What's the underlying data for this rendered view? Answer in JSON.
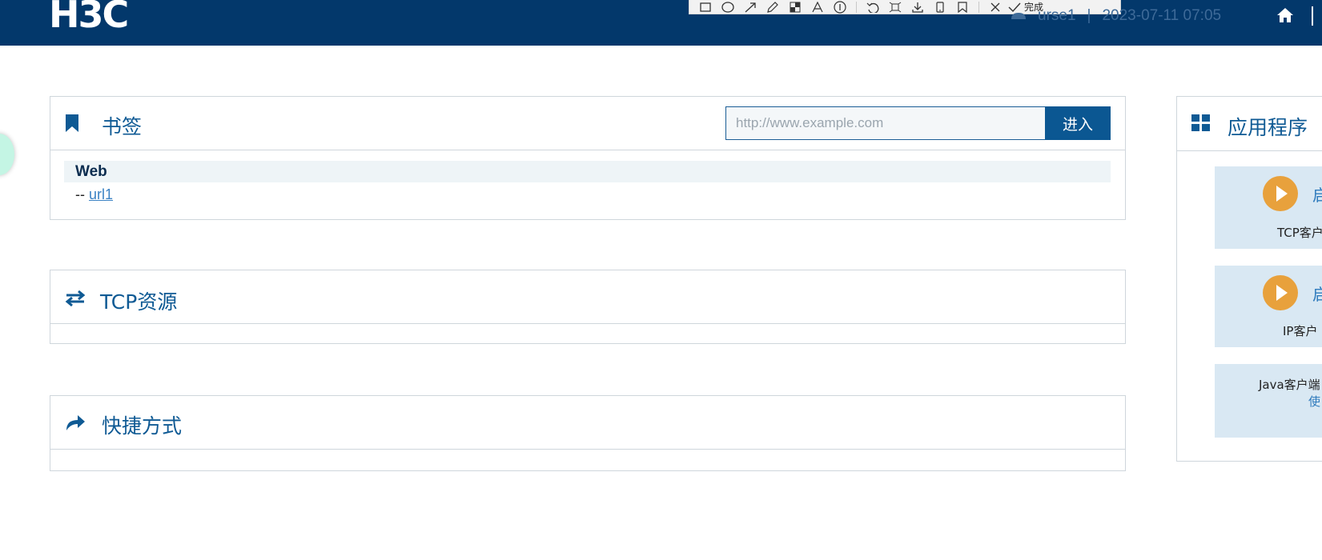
{
  "header": {
    "logo": "H3C",
    "user": "urse1",
    "separator": "|",
    "datetime": "2023-07-11 07:05",
    "home_icon": "home-icon"
  },
  "toolbar": {
    "done_label": "完成"
  },
  "bookmarks": {
    "title": "书签",
    "url_placeholder": "http://www.example.com",
    "enter_label": "进入",
    "groups": [
      {
        "name": "Web",
        "links": [
          {
            "prefix": "--",
            "label": "url1"
          }
        ]
      }
    ]
  },
  "tcp": {
    "title": "TCP资源"
  },
  "shortcuts": {
    "title": "快捷方式"
  },
  "apps": {
    "title": "应用程序",
    "cards": [
      {
        "launch": "启",
        "desc": "TCP客户"
      },
      {
        "launch": "启",
        "desc": "IP客户"
      },
      {
        "desc": "Java客户端",
        "link": "使"
      }
    ]
  },
  "colors": {
    "header_bg": "#03386b",
    "accent": "#0b5792",
    "title": "#0f5a94",
    "card_bg": "#d9e8f3",
    "play_orange": "#e8a13c"
  }
}
